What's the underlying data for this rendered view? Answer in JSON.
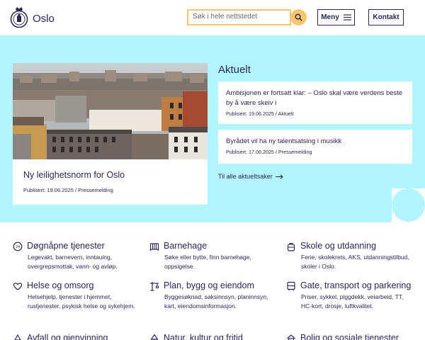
{
  "header": {
    "logo_text": "Oslo",
    "search_placeholder": "Søk i hele nettstedet",
    "menu_label": "Meny",
    "contact_label": "Kontakt"
  },
  "feature": {
    "title": "Ny leilighetsnorm for Oslo",
    "meta": "Publisert: 19.06.2025 / Pressemelding"
  },
  "aktuelt": {
    "title": "Aktuelt",
    "items": [
      {
        "title": "Ambisjonen er fortsatt klar: – Oslo skal være verdens beste by å være skeiv i",
        "meta": "Publisert: 19.06.2025 / Aktuelt"
      },
      {
        "title": "Byrådet vil ha ny talentsatsing i musikk",
        "meta": "Publisert: 17.06.2025 / Pressemelding"
      }
    ],
    "all_link": "Til alle aktueltsaker"
  },
  "services": [
    {
      "title": "Døgnåpne tjenester",
      "desc": "Legevakt, barnevern, inntauing, overgrepsmottak, vann- og avløp.",
      "icon": "clock-icon"
    },
    {
      "title": "Barnehage",
      "desc": "Søke eller bytte, finn barnehage, oppsigelse.",
      "icon": "crib-icon"
    },
    {
      "title": "Skole og utdanning",
      "desc": "Ferie, skolekrets, AKS, utdanningstilbud, skoler i Oslo.",
      "icon": "backpack-icon"
    },
    {
      "title": "Helse og omsorg",
      "desc": "Helsehjelp, tjenester i hjemmet, rustjenester, psykisk helse og sykehjem.",
      "icon": "heart-hand-icon"
    },
    {
      "title": "Plan, bygg og eiendom",
      "desc": "Byggesøknad, saksinnsyn, planinnsyn, kart, eiendomsinformasjon.",
      "icon": "crane-icon"
    },
    {
      "title": "Gate, transport og parkering",
      "desc": "Priser, sykkel, piggdekk, veiarbeid, TT, HC-kort, drosje, luftkvalitet.",
      "icon": "bus-icon"
    },
    {
      "title": "Avfall og gjenvinning",
      "desc": "",
      "icon": "recycle-icon"
    },
    {
      "title": "Natur, kultur og fritid",
      "desc": "",
      "icon": "tree-icon"
    },
    {
      "title": "Bolig og sosiale tjenester",
      "desc": "",
      "icon": "house-icon"
    }
  ]
}
